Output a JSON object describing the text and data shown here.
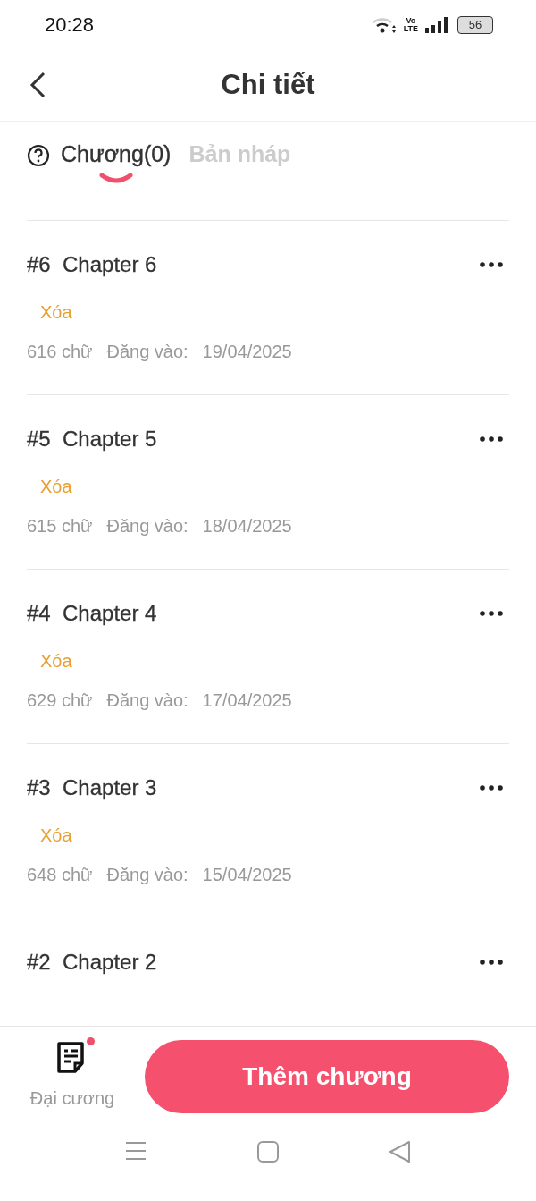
{
  "status_bar": {
    "time": "20:28",
    "battery": "56",
    "network": "Vo LTE"
  },
  "header": {
    "title": "Chi tiết"
  },
  "tabs": [
    {
      "label": "Chương(0)",
      "selected": true
    },
    {
      "label": "Bản nháp",
      "selected": false
    }
  ],
  "chapters": [
    {
      "number": "#6",
      "title": "Chapter 6",
      "action": "Xóa",
      "words": "616 chữ",
      "posted_label": "Đăng vào:",
      "date": "19/04/2025"
    },
    {
      "number": "#5",
      "title": "Chapter 5",
      "action": "Xóa",
      "words": "615 chữ",
      "posted_label": "Đăng vào:",
      "date": "18/04/2025"
    },
    {
      "number": "#4",
      "title": "Chapter 4",
      "action": "Xóa",
      "words": "629 chữ",
      "posted_label": "Đăng vào:",
      "date": "17/04/2025"
    },
    {
      "number": "#3",
      "title": "Chapter 3",
      "action": "Xóa",
      "words": "648 chữ",
      "posted_label": "Đăng vào:",
      "date": "15/04/2025"
    },
    {
      "number": "#2",
      "title": "Chapter 2"
    }
  ],
  "bottom_bar": {
    "outline_label": "Đại cương",
    "outline_badge": true,
    "add_button": "Thêm chương"
  }
}
